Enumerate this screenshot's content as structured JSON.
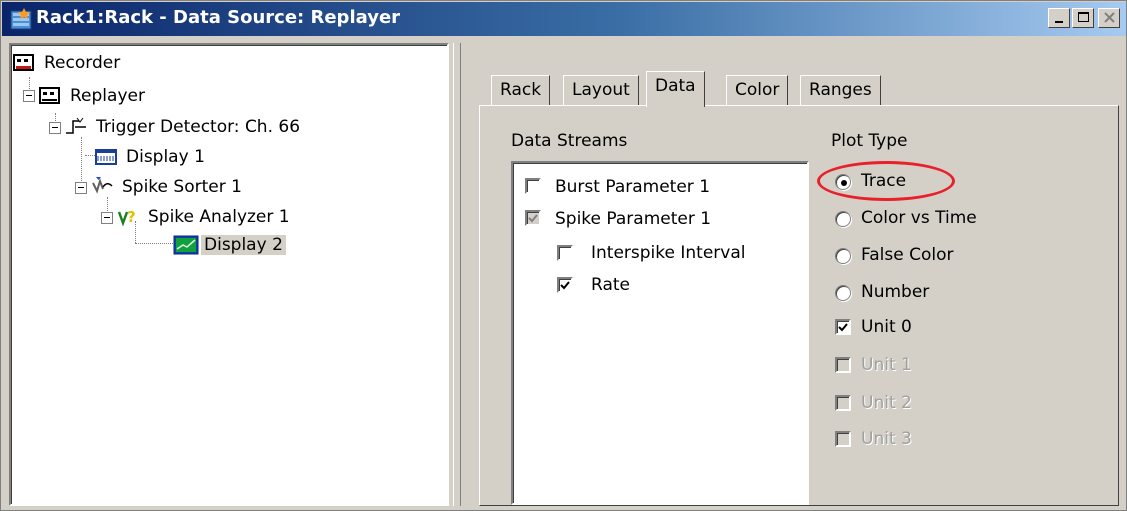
{
  "window": {
    "title": "Rack1:Rack - Data Source: Replayer",
    "icon": "rack-app-icon",
    "controls": [
      "minimize-icon",
      "maximize-icon",
      "close-icon"
    ]
  },
  "tree": {
    "items": [
      {
        "label": "Recorder",
        "icon": "recorder-icon"
      },
      {
        "label": "Replayer",
        "icon": "replayer-icon"
      },
      {
        "label": "Trigger Detector: Ch. 66",
        "icon": "trigger-detector-icon"
      },
      {
        "label": "Display 1",
        "icon": "display-icon"
      },
      {
        "label": "Spike Sorter 1",
        "icon": "spike-sorter-icon"
      },
      {
        "label": "Spike Analyzer 1",
        "icon": "spike-analyzer-icon"
      },
      {
        "label": "Display 2",
        "icon": "plot-display-icon",
        "selected": true
      }
    ]
  },
  "tabs": [
    {
      "label": "Rack"
    },
    {
      "label": "Layout"
    },
    {
      "label": "Data",
      "active": true
    },
    {
      "label": "Color"
    },
    {
      "label": "Ranges"
    }
  ],
  "data_streams": {
    "title": "Data Streams",
    "items": [
      {
        "label": "Burst Parameter 1",
        "checked": false,
        "disabled": false
      },
      {
        "label": "Spike Parameter 1",
        "checked": true,
        "disabled": true
      },
      {
        "label": "Interspike Interval",
        "checked": false,
        "disabled": false
      },
      {
        "label": "Rate",
        "checked": true,
        "disabled": false
      }
    ]
  },
  "plot_type": {
    "title": "Plot Type",
    "options": [
      {
        "label": "Trace",
        "selected": true
      },
      {
        "label": "Color vs Time",
        "selected": false
      },
      {
        "label": "False Color",
        "selected": false
      },
      {
        "label": "Number",
        "selected": false
      }
    ],
    "units": [
      {
        "label": "Unit 0",
        "checked": true,
        "disabled": false
      },
      {
        "label": "Unit 1",
        "checked": false,
        "disabled": true
      },
      {
        "label": "Unit 2",
        "checked": false,
        "disabled": true
      },
      {
        "label": "Unit 3",
        "checked": false,
        "disabled": true
      }
    ]
  },
  "colors": {
    "title_bar_start": "#0a246a",
    "title_bar_end": "#a6caf0",
    "face": "#d4d0c8",
    "annotation_ring": "#e8202a"
  }
}
